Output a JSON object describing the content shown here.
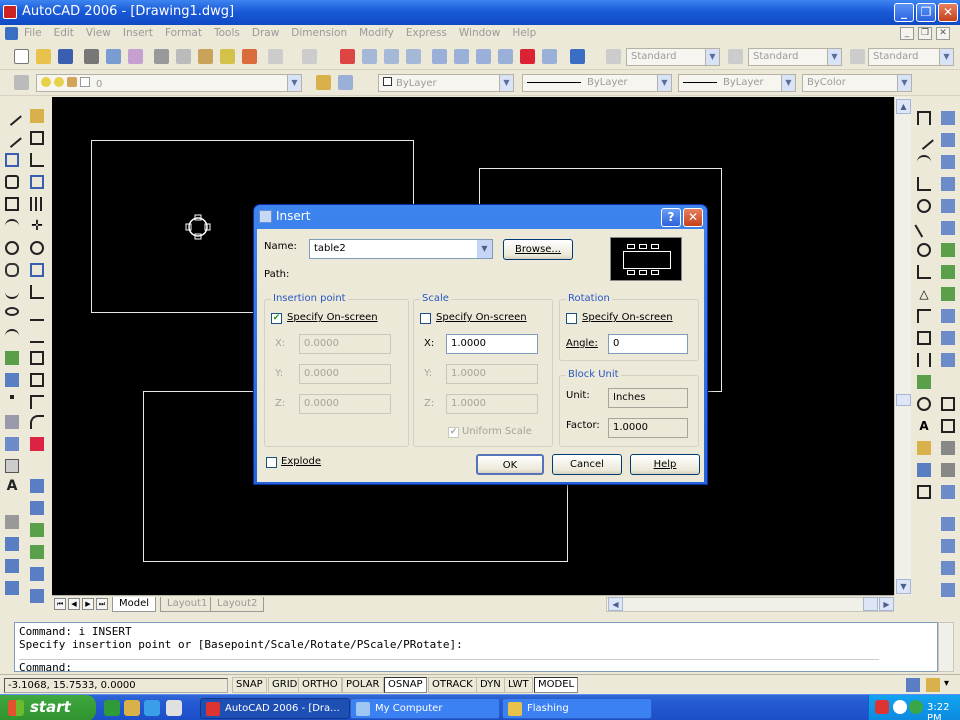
{
  "window": {
    "title": "AutoCAD 2006 - [Drawing1.dwg]"
  },
  "menu": [
    "File",
    "Edit",
    "View",
    "Insert",
    "Format",
    "Tools",
    "Draw",
    "Dimension",
    "Modify",
    "Express",
    "Window",
    "Help"
  ],
  "toolbar": {
    "text_style": "Standard",
    "dim_style": "Standard",
    "table_style": "Standard",
    "layer": "0",
    "color": "ByLayer",
    "linetype": "ByLayer",
    "lineweight": "ByLayer",
    "plot_style": "ByColor"
  },
  "layout_tabs": [
    "Model",
    "Layout1",
    "Layout2"
  ],
  "command": {
    "line1": "Command: i INSERT",
    "line2": "Specify insertion point or [Basepoint/Scale/Rotate/PScale/PRotate]:",
    "prompt": "Command:"
  },
  "status": {
    "coords": "-3.1068, 15.7533, 0.0000",
    "toggles": [
      "SNAP",
      "GRID",
      "ORTHO",
      "POLAR",
      "OSNAP",
      "OTRACK",
      "DYN",
      "LWT",
      "MODEL"
    ]
  },
  "taskbar": {
    "start": "start",
    "tasks": [
      "AutoCAD 2006 - [Dra...",
      "My Computer",
      "Flashing"
    ],
    "clock": "3:22 PM"
  },
  "dialog": {
    "title": "Insert",
    "help_glyph": "?",
    "close_glyph": "✕",
    "name_label": "Name:",
    "name_value": "table2",
    "browse": "Browse...",
    "path_label": "Path:",
    "insertion": {
      "title": "Insertion point",
      "specify": "Specify On-screen",
      "specify_checked": true,
      "x_label": "X:",
      "x": "0.0000",
      "y_label": "Y:",
      "y": "0.0000",
      "z_label": "Z:",
      "z": "0.0000"
    },
    "scale": {
      "title": "Scale",
      "specify": "Specify On-screen",
      "specify_checked": false,
      "x_label": "X:",
      "x": "1.0000",
      "y_label": "Y:",
      "y": "1.0000",
      "z_label": "Z:",
      "z": "1.0000",
      "uniform": "Uniform Scale",
      "uniform_checked": true
    },
    "rotation": {
      "title": "Rotation",
      "specify": "Specify On-screen",
      "specify_checked": false,
      "angle_label": "Angle:",
      "angle": "0"
    },
    "block_unit": {
      "title": "Block Unit",
      "unit_label": "Unit:",
      "unit": "Inches",
      "factor_label": "Factor:",
      "factor": "1.0000"
    },
    "explode": "Explode",
    "ok": "OK",
    "cancel": "Cancel",
    "help": "Help"
  }
}
